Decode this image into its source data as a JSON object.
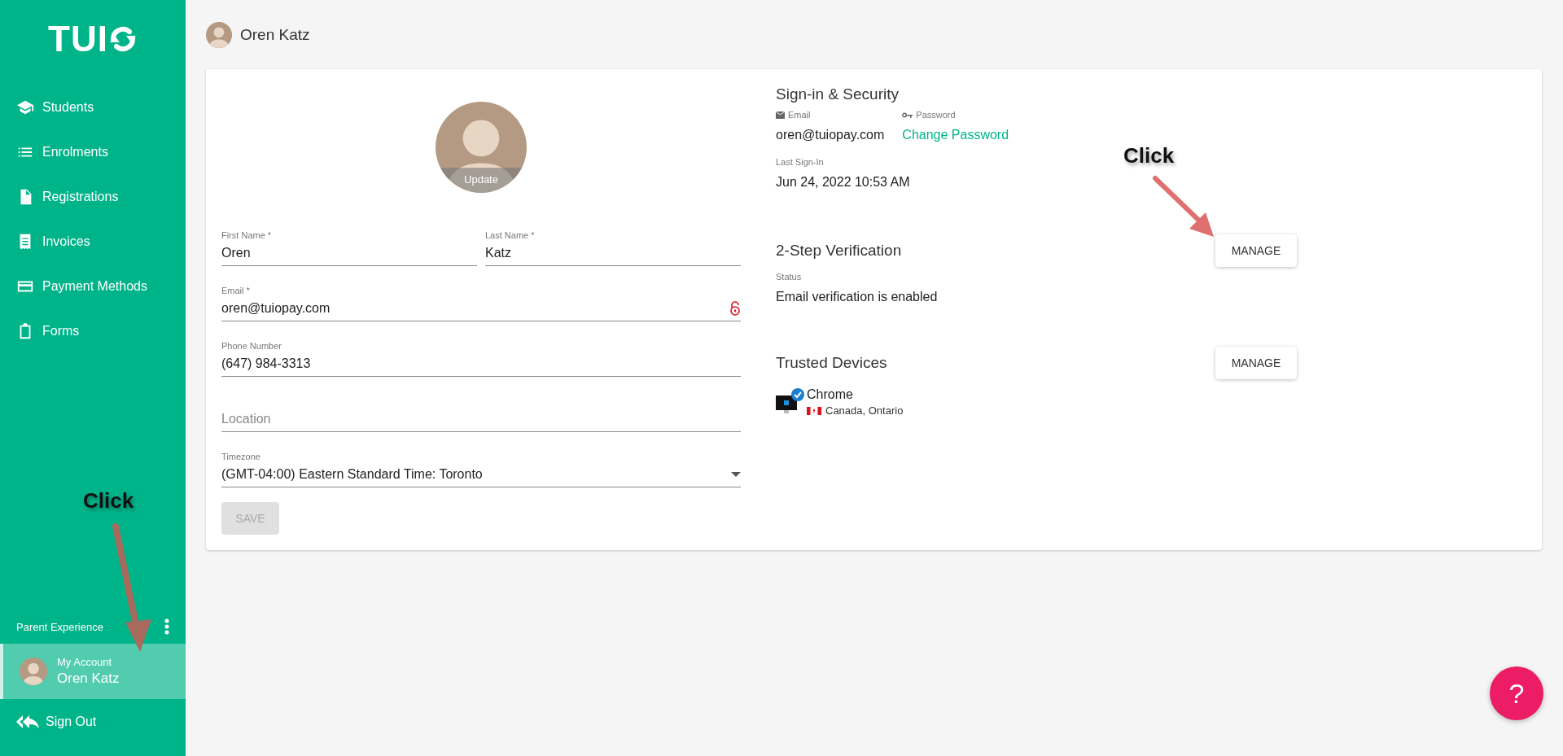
{
  "logo": {
    "text": "TUI"
  },
  "nav": [
    {
      "label": "Students",
      "selected": false
    },
    {
      "label": "Enrolments",
      "selected": false
    },
    {
      "label": "Registrations",
      "selected": false
    },
    {
      "label": "Invoices",
      "selected": false
    },
    {
      "label": "Payment Methods",
      "selected": false
    },
    {
      "label": "Forms",
      "selected": false
    }
  ],
  "section_label": "Parent Experience",
  "account": {
    "caption": "My Account",
    "name": "Oren Katz",
    "selected": true
  },
  "sign_out": "Sign Out",
  "header": {
    "name": "Oren Katz"
  },
  "profile": {
    "update": "Update",
    "fields": [
      {
        "label": "First Name *",
        "value": "Oren",
        "kind": "text"
      },
      {
        "label": "Last Name *",
        "value": "Katz",
        "kind": "text"
      },
      {
        "label": "Email *",
        "value": "oren@tuiopay.com",
        "kind": "locked"
      },
      {
        "label": "Phone Number",
        "value": "(647) 984-3313",
        "kind": "text"
      },
      {
        "placeholder": "Location",
        "kind": "text"
      },
      {
        "label": "Timezone",
        "value": "(GMT-04:00) Eastern Standard Time: Toronto",
        "kind": "select"
      }
    ],
    "save": {
      "label": "SAVE",
      "disabled": true
    }
  },
  "security": {
    "title": "Sign-in & Security",
    "email_label": "Email",
    "email": "oren@tuiopay.com",
    "password_label": "Password",
    "change_password": "Change Password",
    "last_signin_label": "Last Sign-In",
    "last_signin": "Jun 24, 2022 10:53 AM"
  },
  "two_step": {
    "title": "2-Step Verification",
    "button": "MANAGE",
    "status_label": "Status",
    "status": "Email verification is enabled"
  },
  "devices": {
    "title": "Trusted Devices",
    "button": "MANAGE",
    "items": [
      {
        "name": "Chrome",
        "location": "Canada, Ontario"
      }
    ]
  },
  "annotations": [
    {
      "text": "Click"
    },
    {
      "text": "Click"
    }
  ],
  "help": "?"
}
